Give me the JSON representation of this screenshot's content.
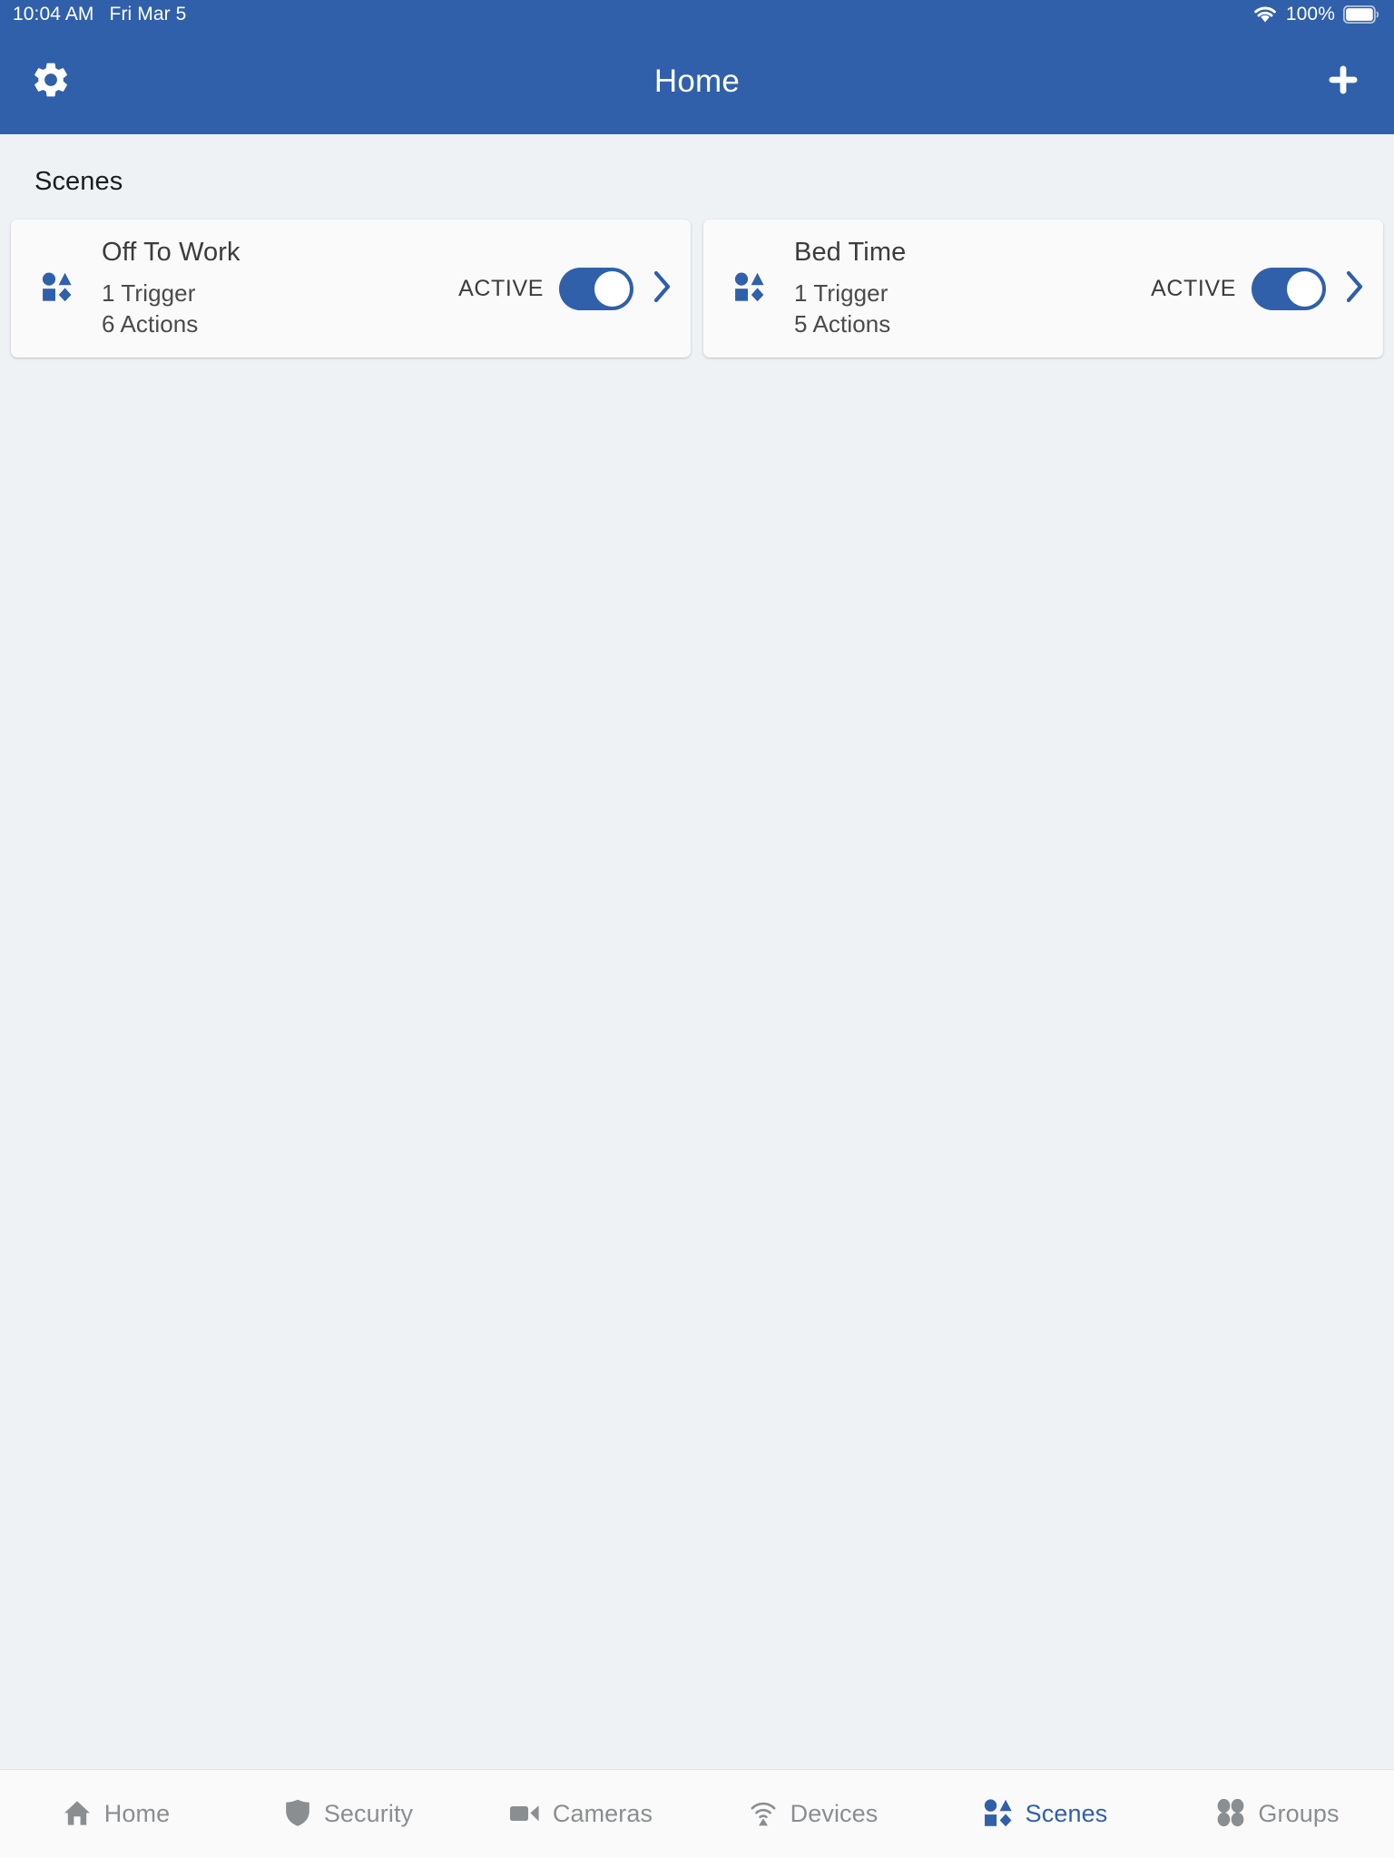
{
  "status_bar": {
    "time": "10:04 AM",
    "date": "Fri Mar 5",
    "battery_percent": "100%",
    "wifi_icon": "wifi-icon",
    "battery_icon": "battery-full-icon"
  },
  "nav_bar": {
    "title": "Home",
    "settings_icon": "gear-icon",
    "add_icon": "plus-icon"
  },
  "content": {
    "section_title": "Scenes",
    "scenes": [
      {
        "name": "Off To Work",
        "trigger_line": "1 Trigger",
        "action_line": "6 Actions",
        "status_label": "ACTIVE",
        "toggle_on": true,
        "icon": "scenes-shapes-icon",
        "chevron_icon": "chevron-right-icon"
      },
      {
        "name": "Bed Time",
        "trigger_line": "1 Trigger",
        "action_line": "5 Actions",
        "status_label": "ACTIVE",
        "toggle_on": true,
        "icon": "scenes-shapes-icon",
        "chevron_icon": "chevron-right-icon"
      }
    ]
  },
  "tab_bar": {
    "items": [
      {
        "label": "Home",
        "icon": "house-icon",
        "active": false
      },
      {
        "label": "Security",
        "icon": "shield-icon",
        "active": false
      },
      {
        "label": "Cameras",
        "icon": "video-camera-icon",
        "active": false
      },
      {
        "label": "Devices",
        "icon": "broadcast-icon",
        "active": false
      },
      {
        "label": "Scenes",
        "icon": "scenes-shapes-icon",
        "active": true
      },
      {
        "label": "Groups",
        "icon": "four-dots-icon",
        "active": false
      }
    ]
  },
  "colors": {
    "brand_blue": "#3060aa",
    "page_background": "#eef2f5",
    "card_background": "#fafafa",
    "inactive_tab": "#8b8e91"
  }
}
